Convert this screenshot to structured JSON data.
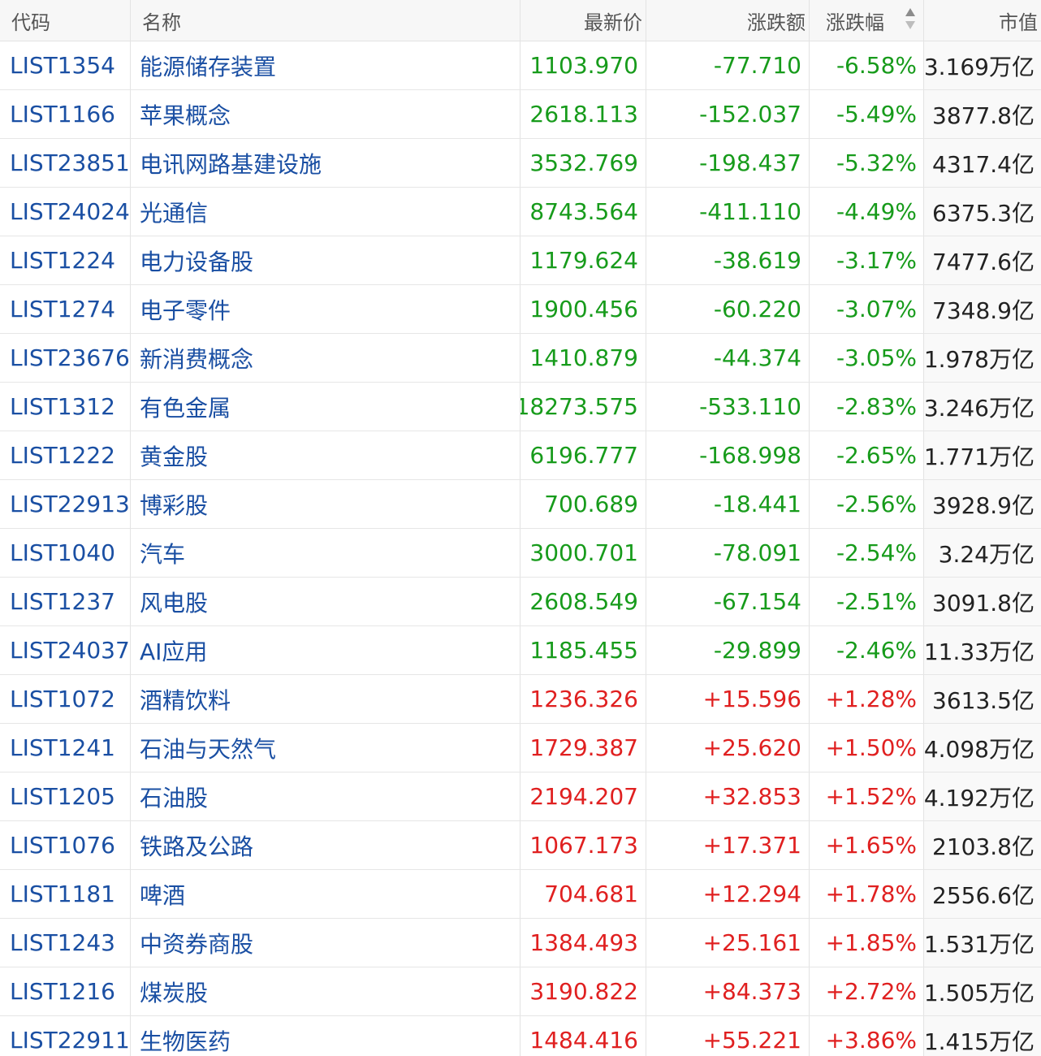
{
  "columns": {
    "code": "代码",
    "name": "名称",
    "price": "最新价",
    "change": "涨跌额",
    "pct": "涨跌幅",
    "cap": "市值"
  },
  "colors": {
    "down": "#179b1b",
    "up": "#e02020",
    "link": "#1a4fa3"
  },
  "icons": {
    "sort": "sort-arrows-icon"
  },
  "rows": [
    {
      "code": "LIST1354",
      "name": "能源储存装置",
      "price": "1103.970",
      "change": "-77.710",
      "pct": "-6.58%",
      "cap": "3.169万亿",
      "dir": "down"
    },
    {
      "code": "LIST1166",
      "name": "苹果概念",
      "price": "2618.113",
      "change": "-152.037",
      "pct": "-5.49%",
      "cap": "3877.8亿",
      "dir": "down"
    },
    {
      "code": "LIST23851",
      "name": "电讯网路基建设施",
      "price": "3532.769",
      "change": "-198.437",
      "pct": "-5.32%",
      "cap": "4317.4亿",
      "dir": "down"
    },
    {
      "code": "LIST24024",
      "name": "光通信",
      "price": "8743.564",
      "change": "-411.110",
      "pct": "-4.49%",
      "cap": "6375.3亿",
      "dir": "down"
    },
    {
      "code": "LIST1224",
      "name": "电力设备股",
      "price": "1179.624",
      "change": "-38.619",
      "pct": "-3.17%",
      "cap": "7477.6亿",
      "dir": "down"
    },
    {
      "code": "LIST1274",
      "name": "电子零件",
      "price": "1900.456",
      "change": "-60.220",
      "pct": "-3.07%",
      "cap": "7348.9亿",
      "dir": "down"
    },
    {
      "code": "LIST23676",
      "name": "新消费概念",
      "price": "1410.879",
      "change": "-44.374",
      "pct": "-3.05%",
      "cap": "1.978万亿",
      "dir": "down"
    },
    {
      "code": "LIST1312",
      "name": "有色金属",
      "price": "18273.575",
      "change": "-533.110",
      "pct": "-2.83%",
      "cap": "3.246万亿",
      "dir": "down"
    },
    {
      "code": "LIST1222",
      "name": "黄金股",
      "price": "6196.777",
      "change": "-168.998",
      "pct": "-2.65%",
      "cap": "1.771万亿",
      "dir": "down"
    },
    {
      "code": "LIST22913",
      "name": "博彩股",
      "price": "700.689",
      "change": "-18.441",
      "pct": "-2.56%",
      "cap": "3928.9亿",
      "dir": "down"
    },
    {
      "code": "LIST1040",
      "name": "汽车",
      "price": "3000.701",
      "change": "-78.091",
      "pct": "-2.54%",
      "cap": "3.24万亿",
      "dir": "down"
    },
    {
      "code": "LIST1237",
      "name": "风电股",
      "price": "2608.549",
      "change": "-67.154",
      "pct": "-2.51%",
      "cap": "3091.8亿",
      "dir": "down"
    },
    {
      "code": "LIST24037",
      "name": "AI应用",
      "price": "1185.455",
      "change": "-29.899",
      "pct": "-2.46%",
      "cap": "11.33万亿",
      "dir": "down"
    },
    {
      "code": "LIST1072",
      "name": "酒精饮料",
      "price": "1236.326",
      "change": "+15.596",
      "pct": "+1.28%",
      "cap": "3613.5亿",
      "dir": "up"
    },
    {
      "code": "LIST1241",
      "name": "石油与天然气",
      "price": "1729.387",
      "change": "+25.620",
      "pct": "+1.50%",
      "cap": "4.098万亿",
      "dir": "up"
    },
    {
      "code": "LIST1205",
      "name": "石油股",
      "price": "2194.207",
      "change": "+32.853",
      "pct": "+1.52%",
      "cap": "4.192万亿",
      "dir": "up"
    },
    {
      "code": "LIST1076",
      "name": "铁路及公路",
      "price": "1067.173",
      "change": "+17.371",
      "pct": "+1.65%",
      "cap": "2103.8亿",
      "dir": "up"
    },
    {
      "code": "LIST1181",
      "name": "啤酒",
      "price": "704.681",
      "change": "+12.294",
      "pct": "+1.78%",
      "cap": "2556.6亿",
      "dir": "up"
    },
    {
      "code": "LIST1243",
      "name": "中资券商股",
      "price": "1384.493",
      "change": "+25.161",
      "pct": "+1.85%",
      "cap": "1.531万亿",
      "dir": "up"
    },
    {
      "code": "LIST1216",
      "name": "煤炭股",
      "price": "3190.822",
      "change": "+84.373",
      "pct": "+2.72%",
      "cap": "1.505万亿",
      "dir": "up"
    },
    {
      "code": "LIST22911",
      "name": "生物医药",
      "price": "1484.416",
      "change": "+55.221",
      "pct": "+3.86%",
      "cap": "1.415万亿",
      "dir": "up"
    }
  ]
}
